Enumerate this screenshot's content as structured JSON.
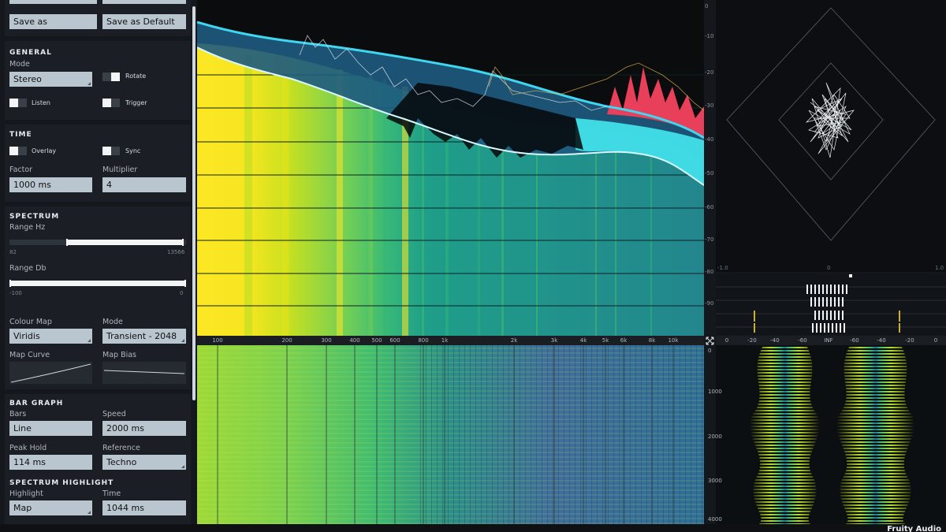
{
  "presets": {
    "save_as": "Save as",
    "save_default": "Save as Default"
  },
  "general": {
    "title": "GENERAL",
    "mode_label": "Mode",
    "mode_value": "Stereo",
    "rotate_label": "Rotate",
    "listen_label": "Listen",
    "trigger_label": "Trigger"
  },
  "time": {
    "title": "TIME",
    "overlay_label": "Overlay",
    "sync_label": "Sync",
    "factor_label": "Factor",
    "factor_value": "1000 ms",
    "multiplier_label": "Multiplier",
    "multiplier_value": "4"
  },
  "spectrum": {
    "title": "SPECTRUM",
    "range_hz_label": "Range Hz",
    "range_hz_min": "82",
    "range_hz_max": "13566",
    "range_db_label": "Range Db",
    "range_db_min": "-100",
    "range_db_max": "0",
    "colour_map_label": "Colour Map",
    "colour_map_value": "Viridis",
    "mode_label": "Mode",
    "mode_value": "Transient - 2048",
    "map_curve_label": "Map Curve",
    "map_bias_label": "Map Bias"
  },
  "bar_graph": {
    "title": "BAR GRAPH",
    "bars_label": "Bars",
    "bars_value": "Line",
    "speed_label": "Speed",
    "speed_value": "2000 ms",
    "peak_hold_label": "Peak Hold",
    "peak_hold_value": "114 ms",
    "reference_label": "Reference",
    "reference_value": "Techno"
  },
  "highlight": {
    "title": "SPECTRUM HIGHLIGHT",
    "highlight_label": "Highlight",
    "highlight_value": "Map",
    "time_label": "Time",
    "time_value": "1044 ms"
  },
  "freq_ticks": [
    "100",
    "200",
    "300",
    "400",
    "500",
    "600",
    "800",
    "1k",
    "2k",
    "3k",
    "4k",
    "5k",
    "6k",
    "8k",
    "10k"
  ],
  "db_ticks": [
    "0",
    "-10",
    "-20",
    "-30",
    "-40",
    "-50",
    "-60",
    "-70",
    "-80",
    "-90"
  ],
  "correlation_ticks": [
    "-1.0",
    "0",
    "1.0"
  ],
  "waveform_ticks": [
    "0",
    "-20",
    "-40",
    "-60",
    "INF",
    "-60",
    "-40",
    "-20",
    "0"
  ],
  "waterfall_ticks": [
    "0",
    "1000",
    "2000",
    "3000",
    "4000"
  ],
  "brand": "Fruity Audio",
  "colors": {
    "accent_cyan": "#3fd6f0",
    "peak_red": "#e8405a",
    "panel": "#1b1f25"
  }
}
